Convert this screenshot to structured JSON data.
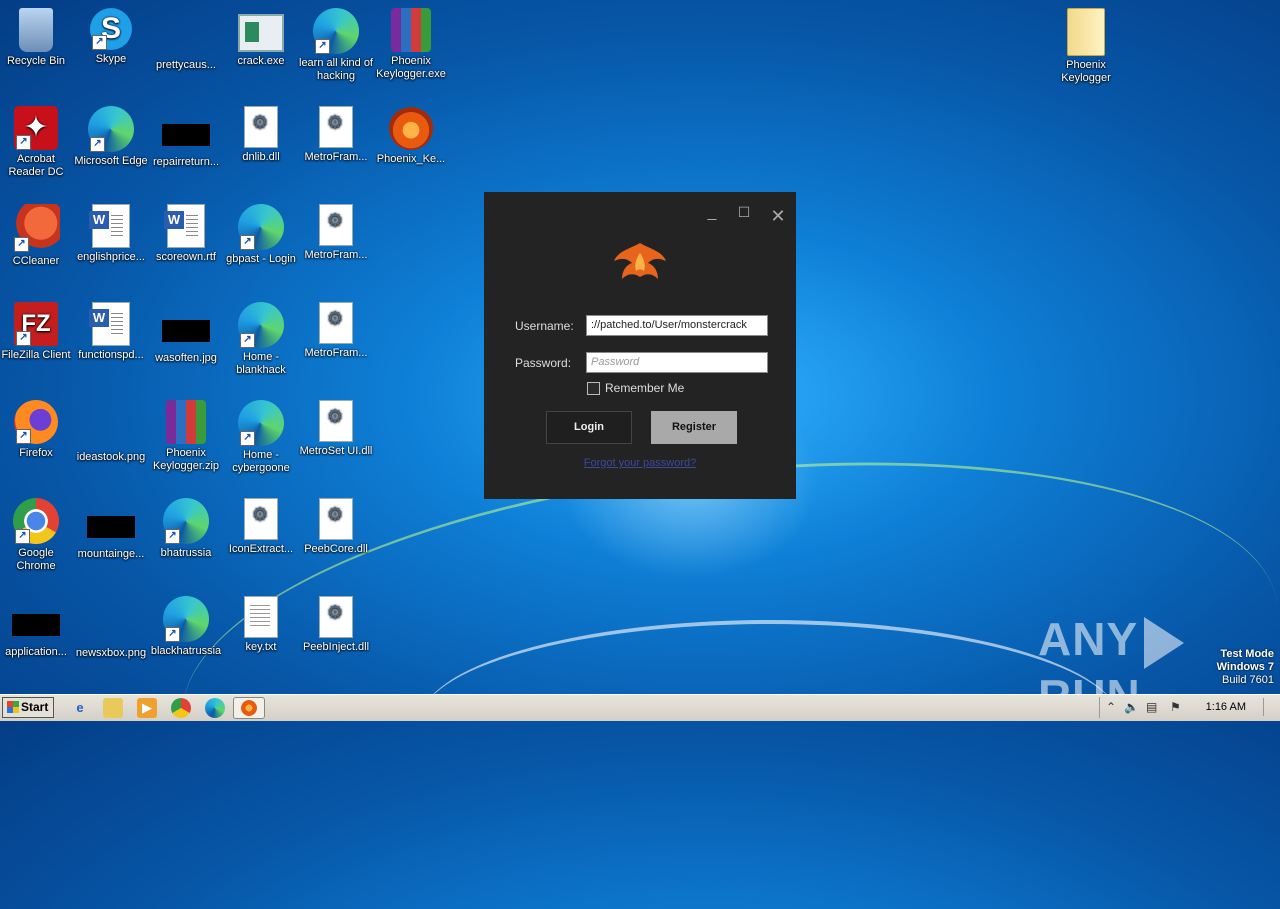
{
  "desktop": {
    "icons": [
      {
        "label": "Recycle Bin",
        "icon": "recycle-bin-icon"
      },
      {
        "label": "Skype",
        "icon": "skype-icon"
      },
      {
        "label": "prettycaus...",
        "icon": "image-file-icon"
      },
      {
        "label": "crack.exe",
        "icon": "exe-icon"
      },
      {
        "label": "learn all kind of hacking",
        "icon": "edge-icon"
      },
      {
        "label": "Phoenix Keylogger.exe",
        "icon": "winrar-sfx-icon"
      },
      {
        "label": "Acrobat Reader DC",
        "icon": "acrobat-icon"
      },
      {
        "label": "Microsoft Edge",
        "icon": "edge-icon"
      },
      {
        "label": "repairreturn...",
        "icon": "image-file-icon"
      },
      {
        "label": "dnlib.dll",
        "icon": "dll-icon"
      },
      {
        "label": "MetroFram...",
        "icon": "dll-icon"
      },
      {
        "label": "Phoenix_Ke...",
        "icon": "phoenix-icon"
      },
      {
        "label": "CCleaner",
        "icon": "ccleaner-icon"
      },
      {
        "label": "englishprice...",
        "icon": "word-doc-icon"
      },
      {
        "label": "scoreown.rtf",
        "icon": "word-doc-icon"
      },
      {
        "label": "gbpast - Login",
        "icon": "edge-icon"
      },
      {
        "label": "MetroFram...",
        "icon": "dll-icon"
      },
      {
        "label": "FileZilla Client",
        "icon": "filezilla-icon"
      },
      {
        "label": "functionspd...",
        "icon": "word-doc-icon"
      },
      {
        "label": "wasoften.jpg",
        "icon": "image-file-icon"
      },
      {
        "label": "Home - blankhack",
        "icon": "edge-icon"
      },
      {
        "label": "MetroFram...",
        "icon": "dll-icon"
      },
      {
        "label": "Firefox",
        "icon": "firefox-icon"
      },
      {
        "label": "ideastook.png",
        "icon": "image-file-icon"
      },
      {
        "label": "Phoenix Keylogger.zip",
        "icon": "winrar-icon"
      },
      {
        "label": "Home - cybergoone",
        "icon": "edge-icon"
      },
      {
        "label": "MetroSet UI.dll",
        "icon": "dll-icon"
      },
      {
        "label": "Google Chrome",
        "icon": "chrome-icon"
      },
      {
        "label": "mountainge...",
        "icon": "image-file-icon"
      },
      {
        "label": "bhatrussia",
        "icon": "edge-icon"
      },
      {
        "label": "IconExtract...",
        "icon": "dll-icon"
      },
      {
        "label": "PeebCore.dll",
        "icon": "dll-icon"
      },
      {
        "label": "application...",
        "icon": "image-file-icon"
      },
      {
        "label": "newsxbox.png",
        "icon": "image-file-icon"
      },
      {
        "label": "blackhatrussia",
        "icon": "edge-icon"
      },
      {
        "label": "key.txt",
        "icon": "text-file-icon"
      },
      {
        "label": "PeebInject.dll",
        "icon": "dll-icon"
      },
      {
        "label": "Phoenix Keylogger",
        "icon": "folder-icon"
      }
    ]
  },
  "login_window": {
    "username_label": "Username:",
    "username_value": "://patched.to/User/monstercrack",
    "password_label": "Password:",
    "password_placeholder": "Password",
    "remember_label": "Remember Me",
    "remember_checked": false,
    "login_label": "Login",
    "register_label": "Register",
    "forgot_label": "Forgot your password?"
  },
  "watermark": {
    "brand": "ANY RUN",
    "line1": "Test Mode",
    "line2": "Windows 7",
    "line3": "Build 7601"
  },
  "taskbar": {
    "start_label": "Start",
    "clock": "1:16 AM",
    "pinned": [
      "ie-icon",
      "explorer-icon",
      "media-player-icon",
      "chrome-icon",
      "edge-icon",
      "phoenix-icon"
    ]
  }
}
